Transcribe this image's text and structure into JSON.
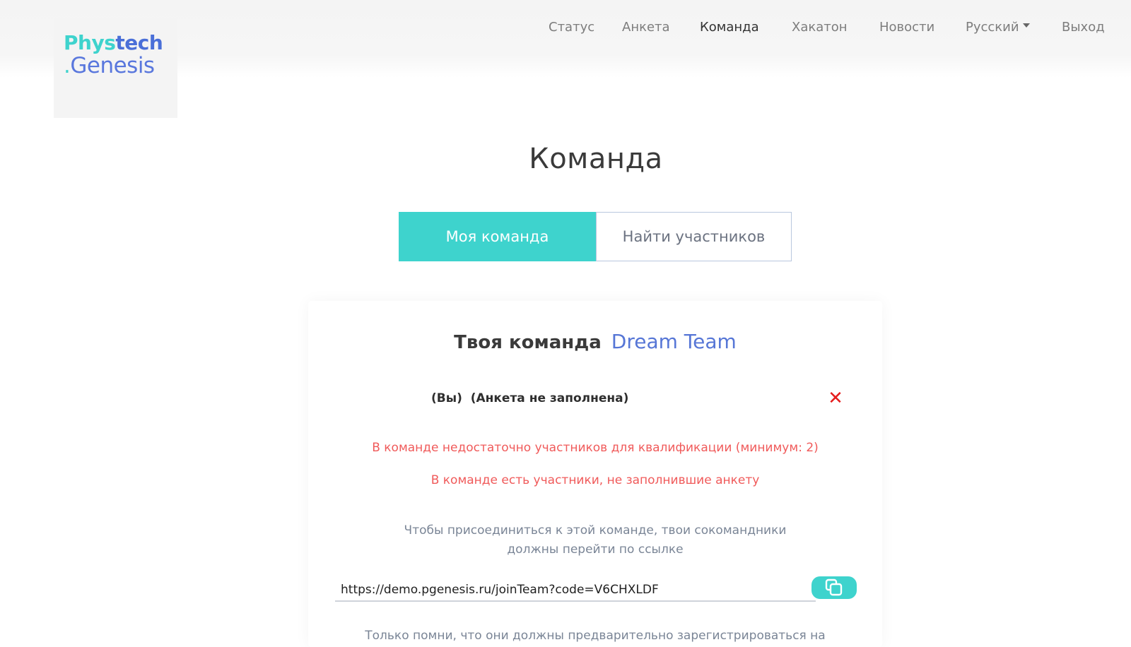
{
  "logo": {
    "line1_part1": "Phys",
    "line1_part2": "tech",
    "line2_dot": ".",
    "line2_text": "Genesis"
  },
  "nav": {
    "items": [
      {
        "label": "Статус"
      },
      {
        "label": "Анкета"
      },
      {
        "label": "Команда"
      },
      {
        "label": "Хакатон"
      },
      {
        "label": "Новости"
      },
      {
        "label": "Русский"
      },
      {
        "label": "Выход"
      }
    ],
    "active": "Команда"
  },
  "page": {
    "title": "Команда"
  },
  "tabs": {
    "my_team": "Моя команда",
    "find_members": "Найти участников"
  },
  "team": {
    "heading_prefix": "Твоя команда",
    "name": "Dream Team",
    "member": {
      "you": "(Вы)",
      "status": "(Анкета не заполнена)"
    },
    "remove_glyph": "✕",
    "warnings": [
      "В команде недостаточно участников для квалификации (минимум: 2)",
      "В команде есть участники, не заполнившие анкету"
    ],
    "join_hint_line1": "Чтобы присоединиться к этой команде, твои сокомандники",
    "join_hint_line2": "должны перейти по ссылке",
    "join_link": "https://demo.pgenesis.ru/joinTeam?code=V6CHXLDF",
    "bottom_note": "Только помни, что они должны предварительно зарегистрироваться на"
  },
  "colors": {
    "accent": "#3ed3cd",
    "brand_blue": "#5676d6",
    "error": "#f05a5a"
  },
  "icons": {
    "remove": "close-icon",
    "copy": "copy-icon",
    "dropdown": "chevron-down-icon"
  }
}
